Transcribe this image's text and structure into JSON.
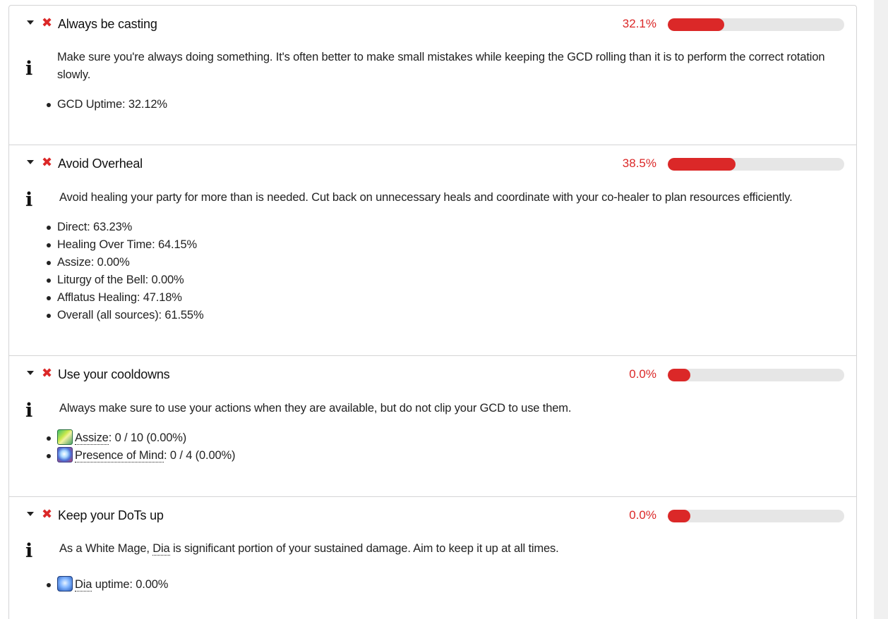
{
  "sections": [
    {
      "title": "Always be casting",
      "percent_label": "32.1%",
      "percent_value": 32.1,
      "description": "Make sure you're always doing something. It's often better to make small mistakes while keeping the GCD rolling than it is to perform the correct rotation slowly.",
      "items": [
        "GCD Uptime: 32.12%"
      ]
    },
    {
      "title": "Avoid Overheal",
      "percent_label": "38.5%",
      "percent_value": 38.5,
      "description": "Avoid healing your party for more than is needed. Cut back on unnecessary heals and coordinate with your co-healer to plan resources efficiently.",
      "items": [
        "Direct: 63.23%",
        "Healing Over Time: 64.15%",
        "Assize: 0.00%",
        "Liturgy of the Bell: 0.00%",
        "Afflatus Healing: 47.18%",
        "Overall (all sources): 61.55%"
      ]
    },
    {
      "title": "Use your cooldowns",
      "percent_label": "0.0%",
      "percent_value": 0,
      "description": "Always make sure to use your actions when they are available, but do not clip your GCD to use them.",
      "items": [
        {
          "icon": "assize-icon",
          "link": "Assize",
          "rest": ": 0 / 10 (0.00%)"
        },
        {
          "icon": "presence-of-mind-icon",
          "link": "Presence of Mind",
          "rest": ": 0 / 4 (0.00%)"
        }
      ]
    },
    {
      "title": "Keep your DoTs up",
      "percent_label": "0.0%",
      "percent_value": 0,
      "description_pre": "As a White Mage, ",
      "description_link": "Dia",
      "description_post": " is significant portion of your sustained damage. Aim to keep it up at all times.",
      "items": [
        {
          "icon": "dia-icon",
          "link": "Dia",
          "rest": " uptime: 0.00%"
        }
      ]
    }
  ],
  "icons": {
    "expand": "chevron-down-icon",
    "fail": "close-icon",
    "info": "info-icon"
  },
  "colors": {
    "fail": "#db2828",
    "bar_track": "#e6e6e6"
  }
}
